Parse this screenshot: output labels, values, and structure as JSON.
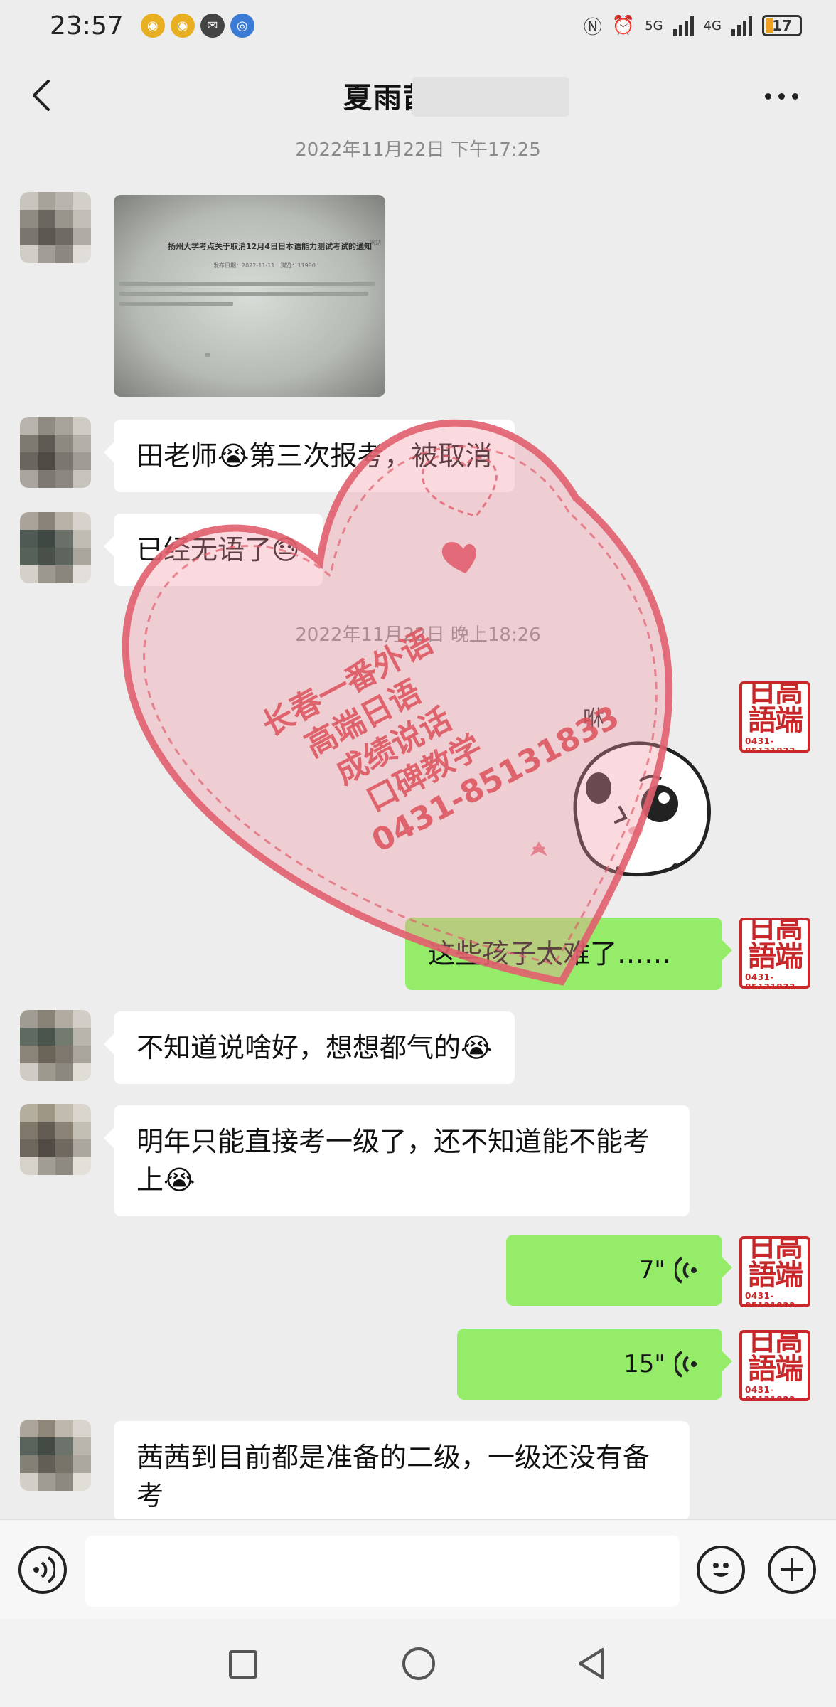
{
  "status_bar": {
    "time": "23:57",
    "network_left": "5G",
    "network_right": "4G",
    "battery": "17"
  },
  "header": {
    "title": "夏雨茜爸爸"
  },
  "messages": {
    "ts1": "2022年11月22日 下午17:25",
    "image_doc_title": "扬州大学考点关于取消12月4日日本语能力测试考试的通知",
    "image_doc_meta": "发布日期：2022-11-11　浏览：11980",
    "m1": "田老师😭第三次报考，被取消",
    "m2": "已经无语了😓",
    "ts2": "2022年11月22日 晚上18:26",
    "m3": "这些孩子太难了……",
    "m4": "不知道说啥好，想想都气的😭",
    "m5": "明年只能直接考一级了，还不知道能不能考上😭",
    "v1": "7\"",
    "v2": "15\"",
    "m6": "茜茜到目前都是准备的二级，一级还没有备考"
  },
  "seal": {
    "top": "日高\n語端",
    "phone": "0431-85131833"
  },
  "watermark": {
    "line1": "长春一番外语",
    "line2": "高端日语",
    "line3": "成绩说话",
    "line4": "口碑教学",
    "line5": "0431-85131833"
  },
  "colors": {
    "background": "#ededed",
    "outgoing_bubble": "#95ec69",
    "incoming_bubble": "#ffffff",
    "seal_red": "#c8282a"
  }
}
